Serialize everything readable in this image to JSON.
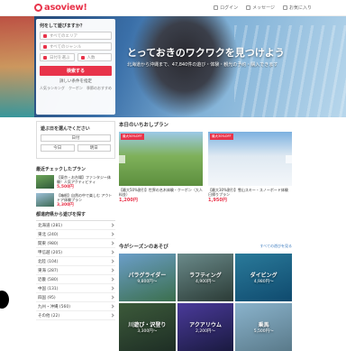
{
  "header": {
    "logo_text": "asoview!",
    "links": [
      {
        "label": "ログイン",
        "icon": "login-icon"
      },
      {
        "label": "メッセージ",
        "icon": "mail-icon"
      },
      {
        "label": "お気に入り",
        "icon": "heart-icon"
      }
    ]
  },
  "hero": {
    "title": "とっておきのワクワクを見つけよう",
    "subtitle": "北海道から沖縄まで、47,840件の遊び・体験・観光の予約・購入できます"
  },
  "search": {
    "title": "何をして遊びますか？",
    "field1": "すべてのエリア",
    "field2": "すべてのジャンル",
    "field3": "日付を選ぶ",
    "field4": "人数",
    "button": "検索する",
    "conditions": "詳しい条件を指定",
    "links": [
      "人気ランキング",
      "クーポン",
      "季節のおすすめ"
    ]
  },
  "date_box": {
    "title": "遊ぶ日を選んでください",
    "any": "日付",
    "today": "今日",
    "tomorrow": "明日"
  },
  "recent": {
    "title": "最近チェックしたプラン",
    "items": [
      {
        "text": "【東京・お台場】ファンタジー体験！人気アクティビティ",
        "price": "5,500円"
      },
      {
        "text": "【箱根】自然の中で楽しむ アウトドア体験プラン",
        "price": "3,300円"
      }
    ]
  },
  "areas": {
    "title": "都道府県から遊びを探す",
    "items": [
      "北海道 (281)",
      "東北 (240)",
      "関東 (980)",
      "甲信越 (205)",
      "北陸 (104)",
      "東海 (287)",
      "近畿 (580)",
      "中国 (131)",
      "四国 (95)",
      "九州・沖縄 (560)",
      "その他 (22)"
    ]
  },
  "plans": {
    "title": "本日のいちおしプラン",
    "cards": [
      {
        "badge": "最大50%OFF",
        "text": "【最大50%割引】世界の名木体験・クーポン（大人料金）",
        "price": "1,200円"
      },
      {
        "badge": "最大30%OFF",
        "text": "【最大30%割引】雪山スキー・スノーボード体験 日帰りプラン",
        "price": "1,950円"
      }
    ]
  },
  "season": {
    "title": "今がシーズンのあそび",
    "more": "すべての遊びを見る",
    "tiles": [
      {
        "name": "パラグライダー",
        "price": "9,800円〜"
      },
      {
        "name": "ラフティング",
        "price": "4,900円〜"
      },
      {
        "name": "ダイビング",
        "price": "4,980円〜"
      },
      {
        "name": "川遊び・沢登り",
        "price": "3,300円〜"
      },
      {
        "name": "アクアリウム",
        "price": "2,200円〜"
      },
      {
        "name": "乗馬",
        "price": "5,500円〜"
      }
    ]
  }
}
